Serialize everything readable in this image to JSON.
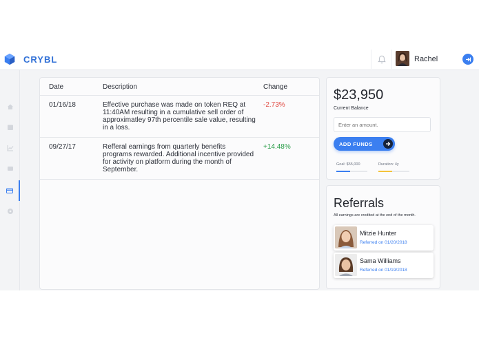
{
  "app": {
    "name": "CRYBL"
  },
  "user": {
    "name": "Rachel"
  },
  "sidebar": {
    "items": [
      {
        "icon": "home-icon"
      },
      {
        "icon": "calendar-icon"
      },
      {
        "icon": "chart-icon"
      },
      {
        "icon": "message-icon"
      },
      {
        "icon": "credit-card-icon",
        "active": true
      },
      {
        "icon": "globe-icon"
      }
    ]
  },
  "transactions": {
    "columns": [
      "Date",
      "Description",
      "Change"
    ],
    "rows": [
      {
        "date": "01/16/18",
        "description": "Effective purchase was made on token REQ at 11:40AM resulting in a cumulative sell order of approximatley 97th percentile sale value, resulting in a loss.",
        "change": "-2.73%"
      },
      {
        "date": "09/27/17",
        "description": "Refferal earnings from quarterly benefits programs rewarded. Additional incentive provided for activity on platform during the month of September.",
        "change": "+14.48%"
      }
    ]
  },
  "balance": {
    "amount": "$23,950",
    "label": "Current Balance",
    "input_placeholder": "Enter an amount.",
    "add_button": "ADD FUNDS",
    "goal_label": "Goal: $55,000",
    "goal_progress": 0.44,
    "duration_label": "Duration: 4y",
    "duration_progress": 0.45,
    "colors": {
      "goal": "#3b7ff0",
      "duration": "#f5c33b"
    }
  },
  "referrals": {
    "title": "Referrals",
    "subtitle": "All earnings are credited at the end of the month.",
    "items": [
      {
        "name": "Mitzie Hunter",
        "date": "Referred on 01/20/2018"
      },
      {
        "name": "Sama Williams",
        "date": "Referred on 01/19/2018"
      }
    ]
  }
}
